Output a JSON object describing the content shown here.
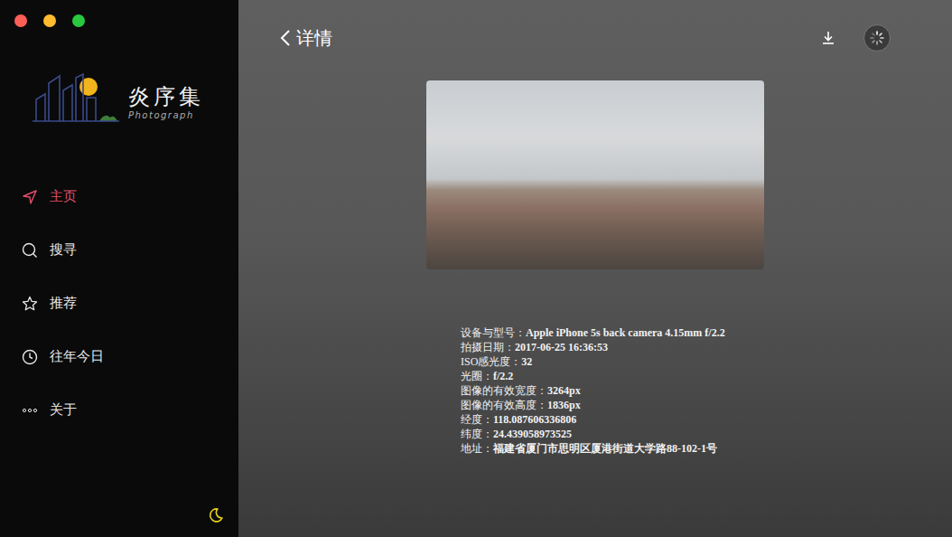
{
  "app": {
    "name": "炎序集",
    "tagline": "Photograph"
  },
  "sidebar": {
    "items": [
      {
        "label": "主页",
        "selected": true
      },
      {
        "label": "搜寻",
        "selected": false
      },
      {
        "label": "推荐",
        "selected": false
      },
      {
        "label": "往年今日",
        "selected": false
      },
      {
        "label": "关于",
        "selected": false
      }
    ]
  },
  "header": {
    "title": "详情"
  },
  "details": [
    {
      "label": "设备与型号：",
      "value": "Apple iPhone 5s back camera 4.15mm f/2.2"
    },
    {
      "label": "拍摄日期：",
      "value": "2017-06-25 16:36:53"
    },
    {
      "label": "ISO感光度：",
      "value": "32"
    },
    {
      "label": "光圈：",
      "value": "f/2.2"
    },
    {
      "label": "图像的有效宽度：",
      "value": "3264px"
    },
    {
      "label": "图像的有效高度：",
      "value": "1836px"
    },
    {
      "label": "经度：",
      "value": "118.087606336806"
    },
    {
      "label": "纬度：",
      "value": "24.439058973525"
    },
    {
      "label": "地址：",
      "value": "福建省厦门市思明区厦港街道大学路88-102-1号"
    }
  ]
}
